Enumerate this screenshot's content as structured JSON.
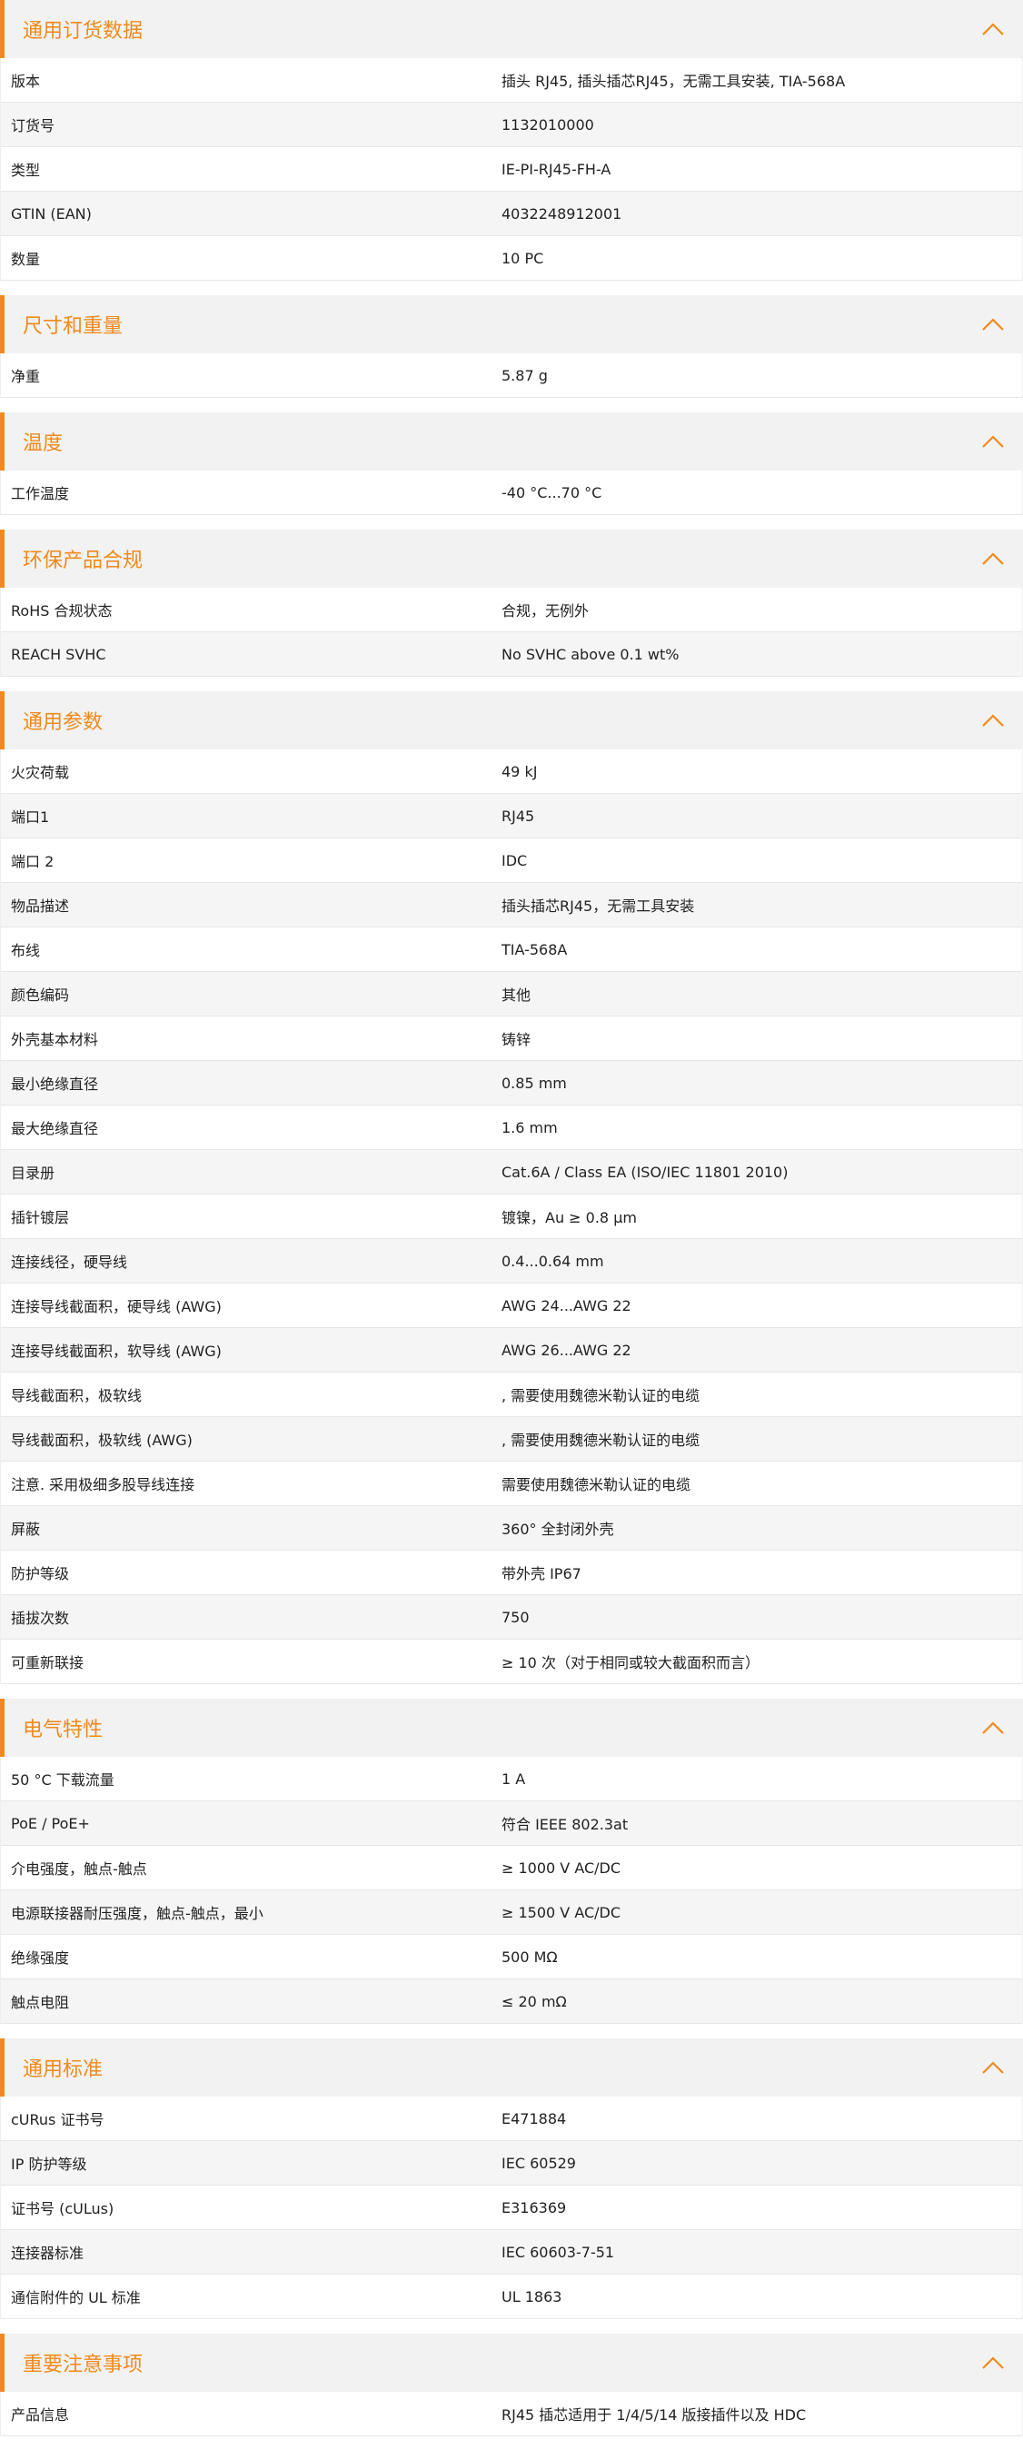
{
  "theme": {
    "accent": "#f08a1c",
    "header_bg": "#f2f2f2",
    "row_alt_bg": "#f5f5f5",
    "collapse_icon": "chevron-up-icon"
  },
  "sections": [
    {
      "title": "通用订货数据",
      "rows": [
        {
          "label": "版本",
          "value": "插头 RJ45, 插头插芯RJ45，无需工具安装, TIA-568A"
        },
        {
          "label": "订货号",
          "value": "1132010000"
        },
        {
          "label": "类型",
          "value": "IE-PI-RJ45-FH-A"
        },
        {
          "label": "GTIN (EAN)",
          "value": "4032248912001"
        },
        {
          "label": "数量",
          "value": "10  PC"
        }
      ]
    },
    {
      "title": "尺寸和重量",
      "rows": [
        {
          "label": "净重",
          "value": "5.87  g"
        }
      ]
    },
    {
      "title": "温度",
      "rows": [
        {
          "label": "工作温度",
          "value": "-40 °C...70 °C"
        }
      ]
    },
    {
      "title": "环保产品合规",
      "rows": [
        {
          "label": "RoHS 合规状态",
          "value": "合规，无例外"
        },
        {
          "label": "REACH SVHC",
          "value": "No SVHC above 0.1 wt%"
        }
      ]
    },
    {
      "title": "通用参数",
      "rows": [
        {
          "label": "火灾荷载",
          "value": "49  kJ"
        },
        {
          "label": "端口1",
          "value": "RJ45"
        },
        {
          "label": "端口 2",
          "value": "IDC"
        },
        {
          "label": "物品描述",
          "value": "插头插芯RJ45，无需工具安装"
        },
        {
          "label": "布线",
          "value": "TIA-568A"
        },
        {
          "label": "颜色编码",
          "value": "其他"
        },
        {
          "label": "外壳基本材料",
          "value": "铸锌"
        },
        {
          "label": "最小绝缘直径",
          "value": "0.85  mm"
        },
        {
          "label": "最大绝缘直径",
          "value": "1.6  mm"
        },
        {
          "label": "目录册",
          "value": "Cat.6A / Class EA (ISO/IEC 11801 2010)"
        },
        {
          "label": "插针镀层",
          "value": "镀镍，Au ≥ 0.8 μm"
        },
        {
          "label": "连接线径，硬导线",
          "value": "0.4...0.64 mm"
        },
        {
          "label": "连接导线截面积，硬导线 (AWG)",
          "value": "AWG 24...AWG 22"
        },
        {
          "label": "连接导线截面积，软导线 (AWG)",
          "value": "AWG 26...AWG 22"
        },
        {
          "label": "导线截面积，极软线",
          "value": ", 需要使用魏德米勒认证的电缆"
        },
        {
          "label": "导线截面积，极软线 (AWG)",
          "value": ", 需要使用魏德米勒认证的电缆"
        },
        {
          "label": "注意. 采用极细多股导线连接",
          "value": "需要使用魏德米勒认证的电缆"
        },
        {
          "label": "屏蔽",
          "value": "360° 全封闭外壳"
        },
        {
          "label": "防护等级",
          "value": "带外壳 IP67"
        },
        {
          "label": "插拔次数",
          "value": "750"
        },
        {
          "label": "可重新联接",
          "value": "≥ 10 次（对于相同或较大截面积而言）"
        }
      ]
    },
    {
      "title": "电气特性",
      "rows": [
        {
          "label": "50 °C 下载流量",
          "value": "1  A"
        },
        {
          "label": "PoE / PoE+",
          "value": "符合 IEEE 802.3at"
        },
        {
          "label": "介电强度，触点-触点",
          "value": "≥ 1000 V AC/DC"
        },
        {
          "label": "电源联接器耐压强度，触点-触点，最小",
          "value": "≥ 1500 V AC/DC"
        },
        {
          "label": "绝缘强度",
          "value": "500 MΩ"
        },
        {
          "label": "触点电阻",
          "value": "≤ 20 mΩ"
        }
      ]
    },
    {
      "title": "通用标准",
      "rows": [
        {
          "label": "cURus 证书号",
          "value": "E471884"
        },
        {
          "label": "IP 防护等级",
          "value": "IEC 60529"
        },
        {
          "label": "证书号 (cULus)",
          "value": "E316369"
        },
        {
          "label": "连接器标准",
          "value": "IEC 60603-7-51"
        },
        {
          "label": "通信附件的 UL 标准",
          "value": "UL 1863"
        }
      ]
    },
    {
      "title": "重要注意事项",
      "rows": [
        {
          "label": "产品信息",
          "value": "RJ45 插芯适用于 1/4/5/14 版接插件以及 HDC"
        }
      ]
    }
  ]
}
